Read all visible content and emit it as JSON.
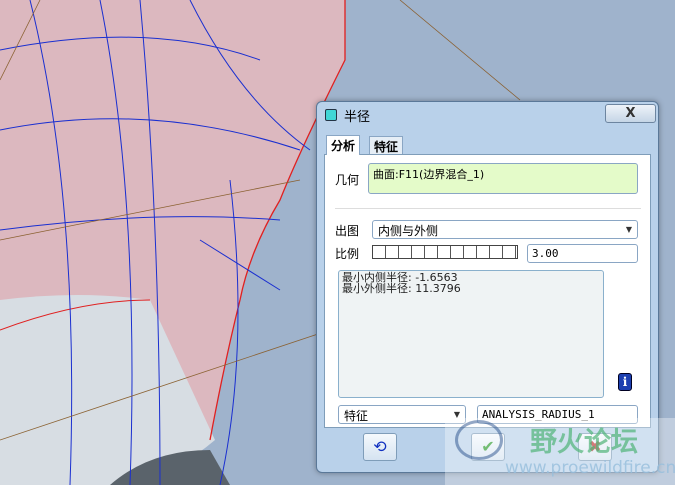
{
  "dialog": {
    "title": "半径",
    "close_label": "X",
    "tabs": [
      {
        "label": "分析",
        "active": true
      },
      {
        "label": "特征",
        "active": false
      }
    ],
    "geometry_label": "几何",
    "geometry_value": "曲面:F11(边界混合_1)",
    "plot_label": "出图",
    "plot_value": "内侧与外侧",
    "scale_label": "比例",
    "scale_value": "3.00",
    "results": [
      "最小内侧半径: -1.6563",
      "最小外侧半径: 11.3796"
    ],
    "type_value": "特征",
    "name_value": "ANALYSIS_RADIUS_1",
    "info_icon": "i"
  },
  "watermark": {
    "title": "野火论坛",
    "url": "www.proewildfire.cn"
  },
  "colors": {
    "surface": "#dcb8bf",
    "background": "#9fb3cc",
    "geometry_field": "#e4fbc9",
    "dialog_frame": "#b9d1ea"
  }
}
